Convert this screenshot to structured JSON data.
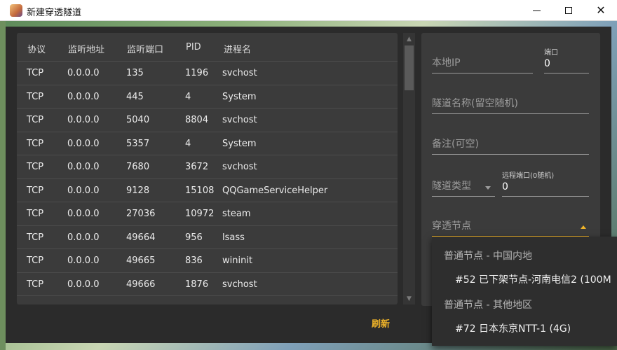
{
  "window": {
    "title": "新建穿透隧道",
    "controls": {
      "minimize": "minimize",
      "maximize": "maximize",
      "close": "close"
    }
  },
  "table": {
    "headers": [
      "协议",
      "监听地址",
      "监听端口",
      "PID",
      "进程名"
    ],
    "rows": [
      [
        "TCP",
        "0.0.0.0",
        "135",
        "1196",
        "svchost"
      ],
      [
        "TCP",
        "0.0.0.0",
        "445",
        "4",
        "System"
      ],
      [
        "TCP",
        "0.0.0.0",
        "5040",
        "8804",
        "svchost"
      ],
      [
        "TCP",
        "0.0.0.0",
        "5357",
        "4",
        "System"
      ],
      [
        "TCP",
        "0.0.0.0",
        "7680",
        "3672",
        "svchost"
      ],
      [
        "TCP",
        "0.0.0.0",
        "9128",
        "15108",
        "QQGameServiceHelper"
      ],
      [
        "TCP",
        "0.0.0.0",
        "27036",
        "10972",
        "steam"
      ],
      [
        "TCP",
        "0.0.0.0",
        "49664",
        "956",
        "lsass"
      ],
      [
        "TCP",
        "0.0.0.0",
        "49665",
        "836",
        "wininit"
      ],
      [
        "TCP",
        "0.0.0.0",
        "49666",
        "1876",
        "svchost"
      ]
    ]
  },
  "footer": {
    "refresh": "刷新"
  },
  "form": {
    "local_ip_placeholder": "本地IP",
    "port_label": "端口",
    "port_value": "0",
    "tunnel_name_placeholder": "隧道名称(留空随机)",
    "remark_placeholder": "备注(可空)",
    "tunnel_type_placeholder": "隧道类型",
    "remote_port_label": "远程端口(0随机)",
    "remote_port_value": "0",
    "node_placeholder": "穿透节点"
  },
  "dropdown": {
    "group1": "普通节点 - 中国内地",
    "item1": "#52 已下架节点-河南电信2 (100M",
    "group2": "普通节点 - 其他地区",
    "item2": "#72 日本东京NTT-1 (4G)"
  },
  "colors": {
    "accent": "#f0b429",
    "panel": "#3b3b3b",
    "window_bg": "#2b2b2b"
  }
}
